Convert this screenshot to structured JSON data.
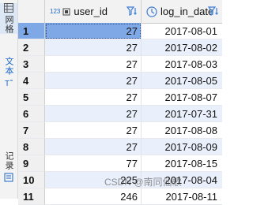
{
  "rail": {
    "tabs": [
      {
        "label": "网格",
        "icon": "grid-icon"
      },
      {
        "label": "文本",
        "icon": "text-icon"
      },
      {
        "label": "记录",
        "icon": "record-icon"
      }
    ]
  },
  "header": {
    "rownum": "",
    "columns": [
      {
        "type_badge": "123",
        "label": "user_id",
        "icon": "key-icon"
      },
      {
        "type_badge": "",
        "label": "log_in_date",
        "icon": "date-icon"
      }
    ]
  },
  "rows": [
    {
      "num": "1",
      "user_id": "27",
      "date": "2017-08-01"
    },
    {
      "num": "2",
      "user_id": "27",
      "date": "2017-08-02"
    },
    {
      "num": "3",
      "user_id": "27",
      "date": "2017-08-03"
    },
    {
      "num": "4",
      "user_id": "27",
      "date": "2017-08-05"
    },
    {
      "num": "5",
      "user_id": "27",
      "date": "2017-08-07"
    },
    {
      "num": "6",
      "user_id": "27",
      "date": "2017-07-31"
    },
    {
      "num": "7",
      "user_id": "27",
      "date": "2017-08-08"
    },
    {
      "num": "8",
      "user_id": "27",
      "date": "2017-08-09"
    },
    {
      "num": "9",
      "user_id": "77",
      "date": "2017-08-15"
    },
    {
      "num": "10",
      "user_id": "225",
      "date": "2017-08-04"
    },
    {
      "num": "11",
      "user_id": "246",
      "date": "2017-08-11"
    }
  ],
  "watermark": "CSDN @南同仙歌",
  "colors": {
    "selected": "#7ea9e6",
    "alt_row": "#eaf0fb",
    "accent": "#1a66c8"
  }
}
